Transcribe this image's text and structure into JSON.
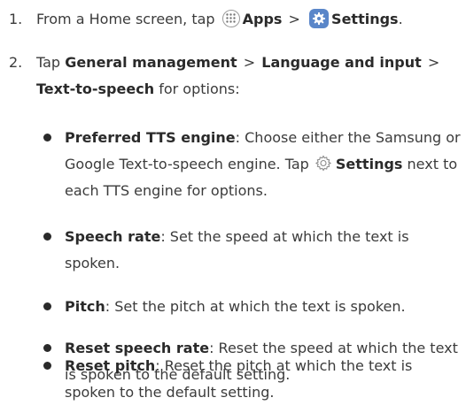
{
  "steps": [
    {
      "number": "1.",
      "prefix": "From a Home screen, tap",
      "apps_label": "Apps",
      "separator": ">",
      "settings_label": "Settings",
      "suffix": "."
    },
    {
      "number": "2.",
      "prefix": "Tap",
      "path": [
        "General management",
        "Language and input",
        "Text-to-speech"
      ],
      "separator": ">",
      "suffix": "for options:"
    }
  ],
  "bullets": [
    {
      "term": "Preferred TTS engine",
      "text_before_icon": ": Choose either the Samsung or Google Text-to-speech engine. Tap",
      "icon_label": "Settings",
      "text_after_icon": "next to each TTS engine for options."
    },
    {
      "term": "Speech rate",
      "text": ": Set the speed at which the text is spoken."
    },
    {
      "term": "Pitch",
      "text": ": Set the pitch at which the text is spoken."
    },
    {
      "term": "Reset speech rate",
      "text": ": Reset the speed at which the text is spoken to the default setting."
    },
    {
      "term": "Reset pitch",
      "text": ": Reset the pitch at which the text is spoken to the default setting."
    }
  ],
  "icons": {
    "apps": "apps-icon",
    "settings": "settings-icon",
    "gear": "gear-icon"
  },
  "colors": {
    "settings_icon_bg": "#5a86c9",
    "text": "#3b3b3b"
  }
}
